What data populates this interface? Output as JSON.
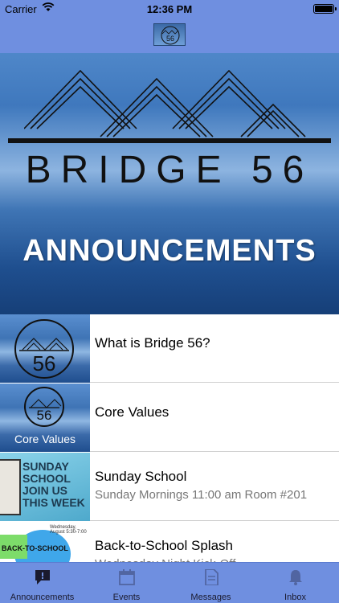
{
  "status_bar": {
    "carrier": "Carrier",
    "time": "12:36 PM"
  },
  "hero": {
    "brand": "BRIDGE 56",
    "title": "ANNOUNCEMENTS"
  },
  "announcements": [
    {
      "title": "What is Bridge 56?",
      "subtitle": "",
      "thumb_text": "56"
    },
    {
      "title": "Core Values",
      "subtitle": "",
      "thumb_text": "56",
      "thumb_caption": "Core Values"
    },
    {
      "title": "Sunday School",
      "subtitle": "Sunday Mornings 11:00 am Room #201",
      "thumb_text": "SUNDAY SCHOOL JOIN US THIS WEEK"
    },
    {
      "title": "Back-to-School Splash",
      "subtitle": "Wednesday Night Kick-Off",
      "thumb_text": "BACK-TO-SCHOOL",
      "thumb_date": "Wednesday, August 5:30-7:00"
    }
  ],
  "tabs": [
    {
      "label": "Announcements",
      "icon": "announcement-icon",
      "active": true
    },
    {
      "label": "Events",
      "icon": "calendar-icon",
      "active": false
    },
    {
      "label": "Messages",
      "icon": "document-icon",
      "active": false
    },
    {
      "label": "Inbox",
      "icon": "bell-icon",
      "active": false
    }
  ],
  "colors": {
    "bar": "#6f8fe0",
    "ocean": "#3f78bd"
  }
}
